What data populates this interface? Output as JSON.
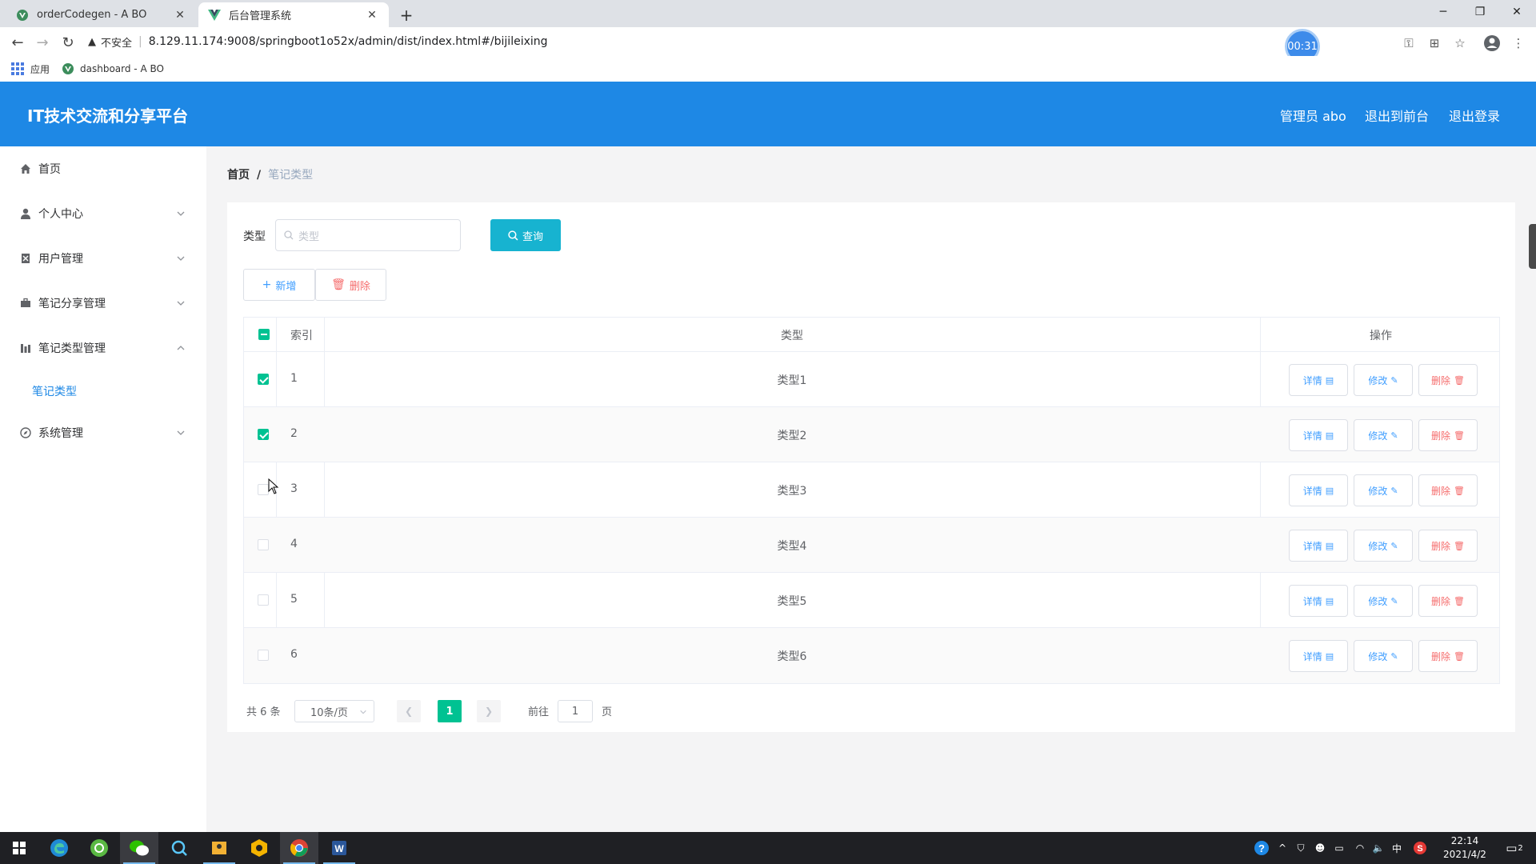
{
  "browser": {
    "tabs": [
      {
        "title": "orderCodegen - A BO",
        "icon": "vue-icon-circle"
      },
      {
        "title": "后台管理系统",
        "icon": "vue-icon"
      }
    ],
    "insecure_label": "不安全",
    "url": "8.129.11.174:9008/springboot1o52x/admin/dist/index.html#/bijileixing",
    "timer": "00:31",
    "bookmarks": [
      {
        "label": "应用",
        "icon": "apps-grid-icon"
      },
      {
        "label": "dashboard - A BO",
        "icon": "vue-icon-circle"
      }
    ]
  },
  "header": {
    "title": "IT技术交流和分享平台",
    "admin": "管理员 abo",
    "to_front": "退出到前台",
    "logout": "退出登录"
  },
  "sidebar": {
    "items": [
      {
        "label": "首页",
        "icon": "home-icon"
      },
      {
        "label": "个人中心",
        "icon": "user-icon"
      },
      {
        "label": "用户管理",
        "icon": "user-manage-icon"
      },
      {
        "label": "笔记分享管理",
        "icon": "briefcase-icon"
      },
      {
        "label": "笔记类型管理",
        "icon": "chart-icon"
      },
      {
        "label": "系统管理",
        "icon": "compass-icon"
      }
    ],
    "sub_item": "笔记类型"
  },
  "breadcrumb": {
    "home": "首页",
    "sep": "/",
    "current": "笔记类型"
  },
  "search": {
    "label": "类型",
    "placeholder": "类型",
    "button": "查询"
  },
  "actions": {
    "add": "新增",
    "delete": "删除"
  },
  "table": {
    "headers": {
      "index": "索引",
      "type": "类型",
      "ops": "操作"
    },
    "rows": [
      {
        "index": "1",
        "type": "类型1",
        "checked": true
      },
      {
        "index": "2",
        "type": "类型2",
        "checked": true
      },
      {
        "index": "3",
        "type": "类型3",
        "checked": false
      },
      {
        "index": "4",
        "type": "类型4",
        "checked": false
      },
      {
        "index": "5",
        "type": "类型5",
        "checked": false
      },
      {
        "index": "6",
        "type": "类型6",
        "checked": false
      }
    ],
    "row_buttons": {
      "detail": "详情",
      "edit": "修改",
      "delete": "删除"
    }
  },
  "pagination": {
    "total": "共 6 条",
    "page_size": "10条/页",
    "current": "1",
    "goto": "前往",
    "goto_value": "1",
    "page_unit": "页"
  },
  "taskbar": {
    "time": "22:14",
    "date": "2021/4/2",
    "notifications": "2",
    "ime": "中"
  },
  "colors": {
    "header": "#1e88e5",
    "accent": "#00c292",
    "query": "#17b3d0",
    "danger": "#f56c6c",
    "primary": "#409eff"
  }
}
